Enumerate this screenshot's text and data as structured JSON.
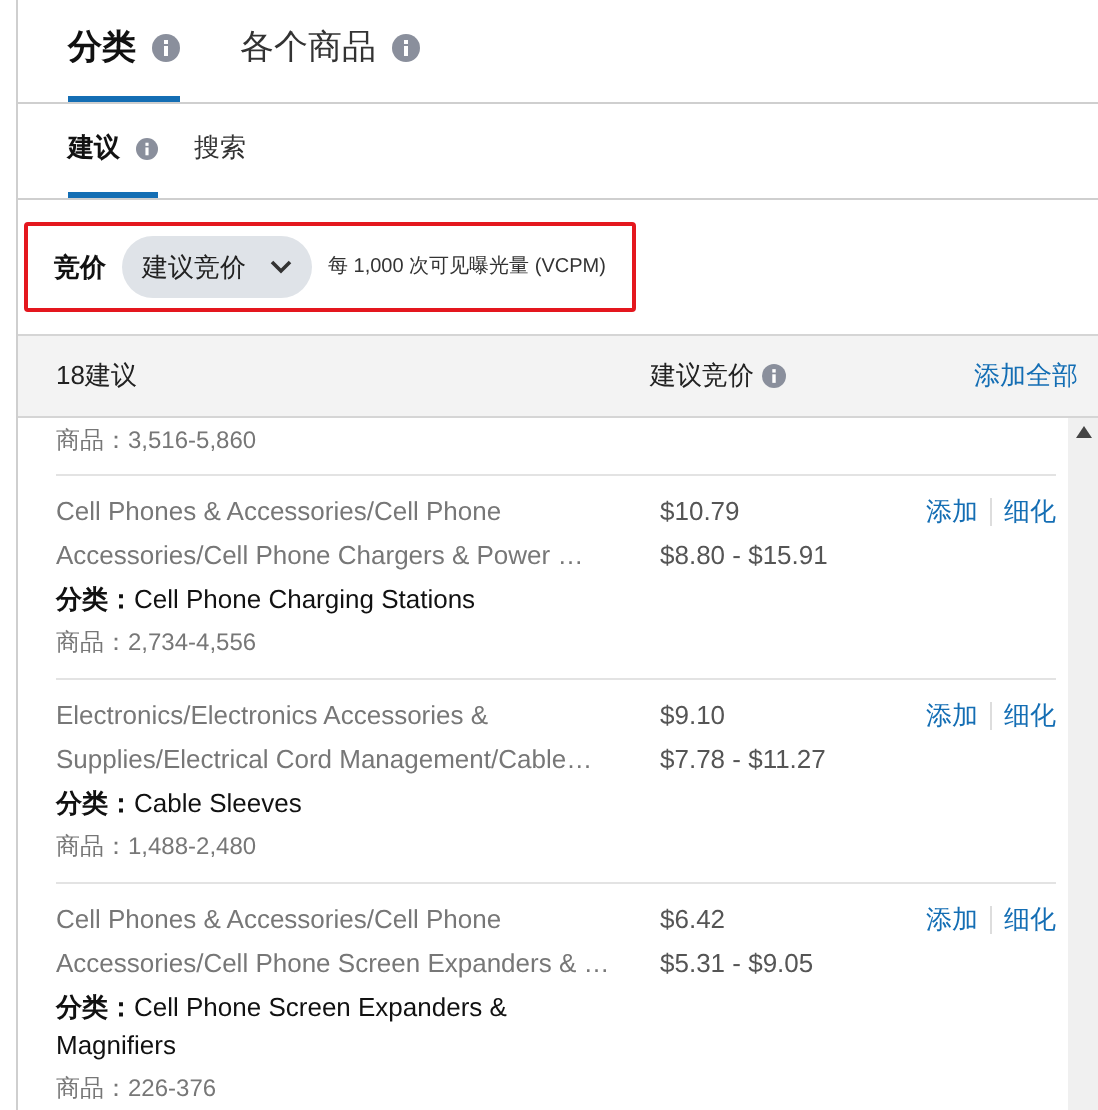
{
  "tabs": [
    {
      "label": "分类",
      "selected": true
    },
    {
      "label": "各个商品",
      "selected": false
    }
  ],
  "sub_tabs": [
    {
      "label": "建议",
      "selected": true,
      "info": true
    },
    {
      "label": "搜索",
      "selected": false,
      "info": false
    }
  ],
  "bid": {
    "label": "竞价",
    "dropdown": "建议竞价",
    "note": "每 1,000 次可见曝光量 (VCPM)",
    "highlighted": true
  },
  "table": {
    "count_header": "18建议",
    "bid_header": "建议竞价",
    "add_all": "添加全部",
    "rows": [
      {
        "products": "商品：3,516-5,860"
      },
      {
        "path_lines": [
          "Cell Phones & Accessories/Cell Phone",
          "Accessories/Cell Phone Chargers & Power …"
        ],
        "bid": "$10.79",
        "range": "$8.80 - $15.91",
        "category_label": "分类：",
        "category": "Cell Phone Charging Stations",
        "products": "商品：2,734-4,556",
        "add": "添加",
        "refine": "细化"
      },
      {
        "path_lines": [
          "Electronics/Electronics Accessories &",
          "Supplies/Electrical Cord Management/Cable…"
        ],
        "bid": "$9.10",
        "range": "$7.78 - $11.27",
        "category_label": "分类：",
        "category": "Cable Sleeves",
        "products": "商品：1,488-2,480",
        "add": "添加",
        "refine": "细化"
      },
      {
        "path_lines": [
          "Cell Phones & Accessories/Cell Phone",
          "Accessories/Cell Phone Screen Expanders & …"
        ],
        "bid": "$6.42",
        "range": "$5.31 - $9.05",
        "category_label": "分类：",
        "category": "Cell Phone Screen Expanders & Magnifiers",
        "products": "商品：226-376",
        "add": "添加",
        "refine": "细化"
      }
    ]
  }
}
